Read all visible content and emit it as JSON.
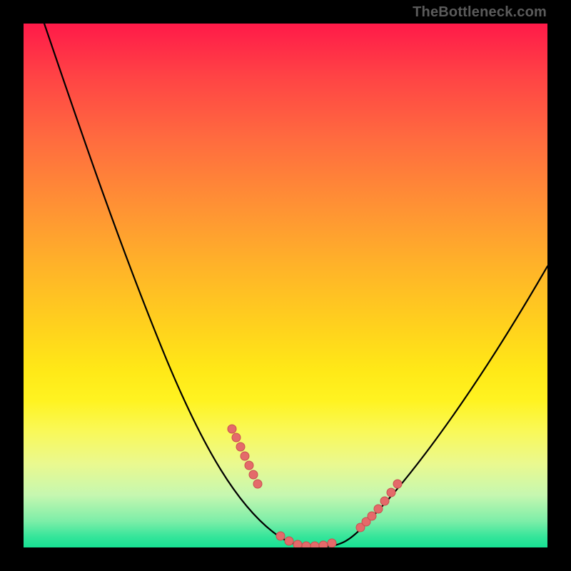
{
  "attribution": "TheBottleneck.com",
  "colors": {
    "page_bg": "#000000",
    "gradient_top": "#ff1a49",
    "gradient_mid": "#ffd21d",
    "gradient_bottom": "#17e193",
    "curve_stroke": "#000000",
    "marker_fill": "#e46a6a",
    "marker_stroke": "#c94f4f"
  },
  "chart_data": {
    "type": "line",
    "title": "",
    "xlabel": "",
    "ylabel": "",
    "xlim": [
      0,
      100
    ],
    "ylim": [
      0,
      100
    ],
    "grid": false,
    "series": [
      {
        "name": "bottleneck-curve",
        "x": [
          4,
          8,
          12,
          16,
          20,
          24,
          28,
          32,
          36,
          40,
          44,
          48,
          50,
          52,
          54,
          56,
          58,
          60,
          64,
          68,
          72,
          76,
          80,
          84,
          88,
          92,
          96,
          100
        ],
        "values": [
          100,
          92,
          84,
          75,
          66,
          57,
          48,
          39,
          30,
          22,
          14,
          7,
          4,
          2,
          1,
          1,
          1,
          2,
          5,
          9,
          15,
          21,
          28,
          35,
          42,
          48,
          52,
          54
        ]
      }
    ],
    "markers": {
      "name": "highlight-dots",
      "x": [
        40,
        41,
        42,
        43,
        44,
        48,
        49,
        50,
        51,
        52,
        55,
        56,
        57,
        58,
        63,
        64,
        65,
        66,
        67,
        68
      ],
      "values": [
        22,
        20,
        18,
        16,
        14,
        7,
        5,
        4,
        3,
        2,
        1,
        1,
        1,
        2,
        4,
        5,
        7,
        8,
        9,
        10
      ]
    }
  }
}
